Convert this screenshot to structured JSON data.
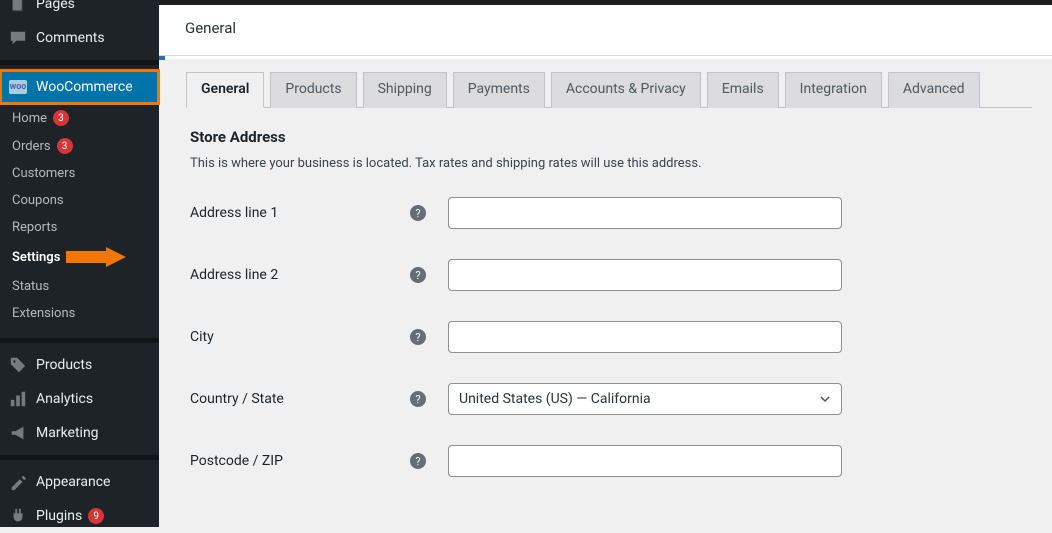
{
  "sidebar": {
    "pages": "Pages",
    "comments": "Comments",
    "woocommerce": "WooCommerce",
    "submenu": {
      "home": "Home",
      "home_badge": "3",
      "orders": "Orders",
      "orders_badge": "3",
      "customers": "Customers",
      "coupons": "Coupons",
      "reports": "Reports",
      "settings": "Settings",
      "status": "Status",
      "extensions": "Extensions"
    },
    "products": "Products",
    "analytics": "Analytics",
    "marketing": "Marketing",
    "appearance": "Appearance",
    "plugins": "Plugins",
    "plugins_badge": "9"
  },
  "header": {
    "title": "General"
  },
  "tabs": {
    "general": "General",
    "products": "Products",
    "shipping": "Shipping",
    "payments": "Payments",
    "accounts": "Accounts & Privacy",
    "emails": "Emails",
    "integration": "Integration",
    "advanced": "Advanced"
  },
  "section": {
    "title": "Store Address",
    "desc": "This is where your business is located. Tax rates and shipping rates will use this address."
  },
  "fields": {
    "addr1": {
      "label": "Address line 1",
      "value": ""
    },
    "addr2": {
      "label": "Address line 2",
      "value": ""
    },
    "city": {
      "label": "City",
      "value": ""
    },
    "country": {
      "label": "Country / State",
      "value": "United States (US) — California"
    },
    "postcode": {
      "label": "Postcode / ZIP",
      "value": ""
    }
  },
  "help_glyph": "?"
}
